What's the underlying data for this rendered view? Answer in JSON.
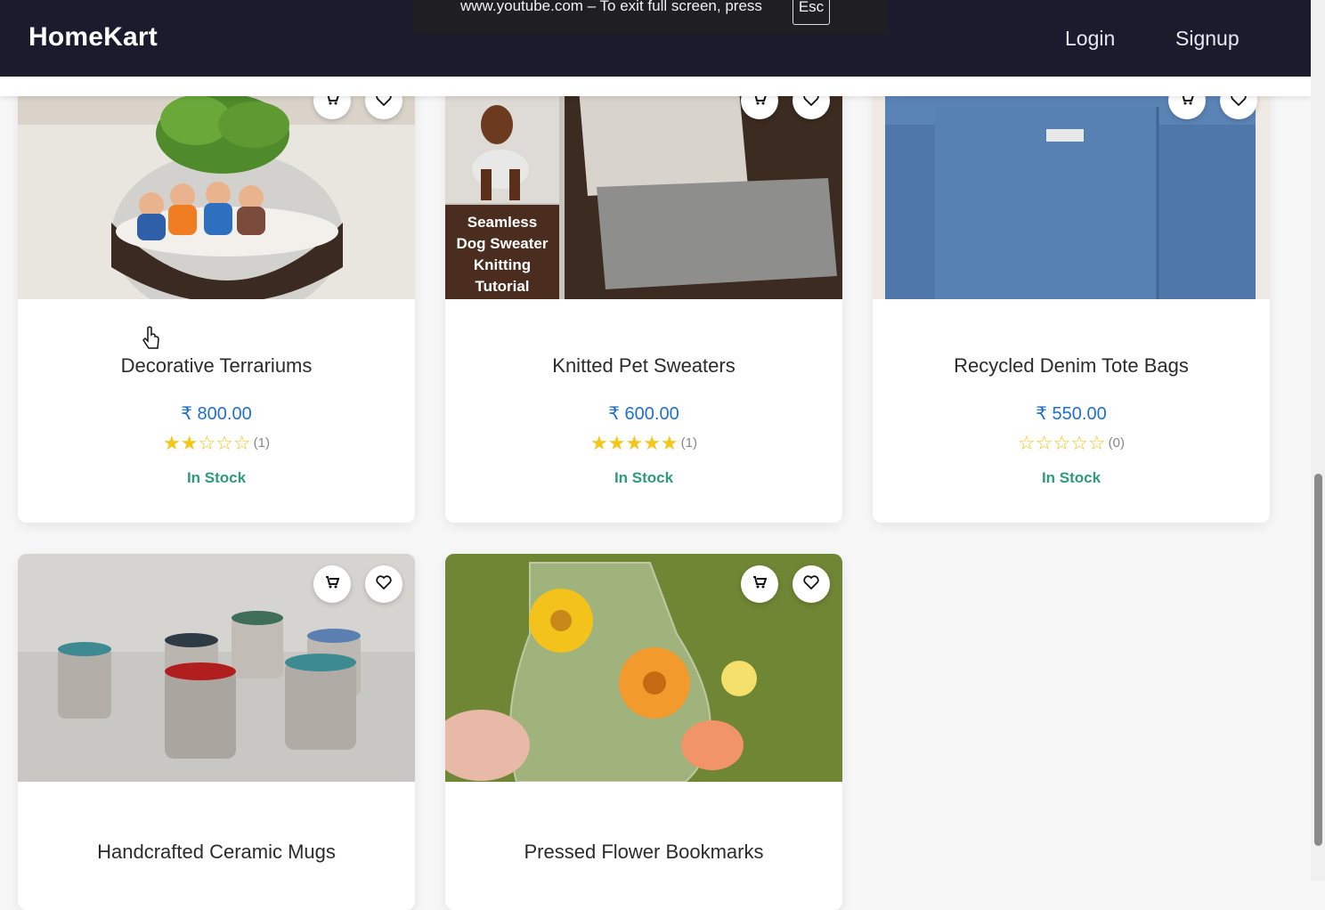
{
  "navbar": {
    "brand": "HomeKart",
    "login": "Login",
    "signup": "Signup"
  },
  "fullscreen_notice": {
    "text": "www.youtube.com – To exit full screen, press",
    "key": "Esc"
  },
  "products": [
    {
      "title": "Decorative Terrariums",
      "price": "₹ 800.00",
      "rating": 2,
      "rating_out_of": 5,
      "reviews": "(1)",
      "stock": "In Stock",
      "image_caption": ""
    },
    {
      "title": "Knitted Pet Sweaters",
      "price": "₹ 600.00",
      "rating": 5,
      "rating_out_of": 5,
      "reviews": "(1)",
      "stock": "In Stock",
      "image_caption": "Seamless Dog Sweater Knitting Tutorial"
    },
    {
      "title": "Recycled Denim Tote Bags",
      "price": "₹ 550.00",
      "rating": 0,
      "rating_out_of": 5,
      "reviews": "(0)",
      "stock": "In Stock",
      "image_caption": ""
    },
    {
      "title": "Handcrafted Ceramic Mugs",
      "price": "",
      "rating": null,
      "rating_out_of": 5,
      "reviews": "",
      "stock": "",
      "image_caption": ""
    },
    {
      "title": "Pressed Flower Bookmarks",
      "price": "",
      "rating": null,
      "rating_out_of": 5,
      "reviews": "",
      "stock": "",
      "image_caption": ""
    }
  ],
  "icons": {
    "cart": "cart-icon",
    "wishlist": "heart-icon"
  },
  "colors": {
    "navbar_bg": "#1c1b2e",
    "price": "#1f6fd1",
    "stock": "#2e9a7a",
    "star": "#f5c518"
  }
}
